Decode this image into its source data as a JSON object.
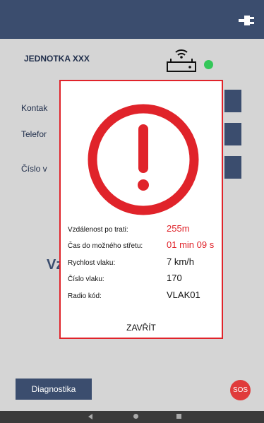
{
  "header": {
    "icon": "plug-icon"
  },
  "main": {
    "unit_label": "JEDNOTKA XXX",
    "status_color": "#34c759",
    "rows": [
      {
        "label": "Kontak"
      },
      {
        "label": "Telefor"
      },
      {
        "label": "Číslo v"
      }
    ],
    "bg_text": "Vz"
  },
  "footer": {
    "diagnostics_label": "Diagnostika",
    "sos_label": "SOS"
  },
  "dialog": {
    "border_color": "#e0232a",
    "icon": "alert-exclamation-icon",
    "info": [
      {
        "label": "Vzdálenost po trati:",
        "value": "255m",
        "highlight": true
      },
      {
        "label": "Čas do možného střetu:",
        "value": "01 min 09 s",
        "highlight": true
      },
      {
        "label": "Rychlost vlaku:",
        "value": "7 km/h",
        "highlight": false
      },
      {
        "label": "Číslo vlaku:",
        "value": "170",
        "highlight": false
      },
      {
        "label": "Radio kód:",
        "value": "VLAK01",
        "highlight": false
      }
    ],
    "close_label": "ZAVŘÍT"
  }
}
